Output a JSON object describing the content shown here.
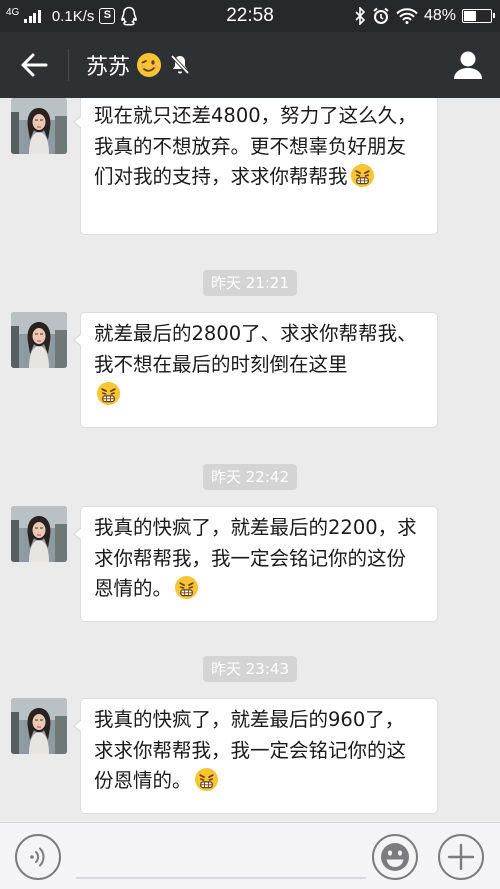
{
  "status_bar": {
    "network_type": "4G",
    "speed": "0.1K/s",
    "app_badge": "S",
    "time": "22:58",
    "battery_percent": "48%",
    "battery_level": 0.48
  },
  "header": {
    "contact_name": "苏苏",
    "icons": [
      "back-arrow-icon",
      "wink-emoji-icon",
      "mute-bell-icon",
      "contact-person-icon"
    ]
  },
  "messages": [
    {
      "type": "text",
      "text": "现在就只还差4800，努力了这么久，我真的不想放弃。更不想辜负好朋友们对我的支持，求求你帮帮我",
      "emoji": "grimace-emoji"
    },
    {
      "type": "timestamp",
      "text": "昨天 21:21"
    },
    {
      "type": "text",
      "text": "就差最后的2800了、求求你帮帮我、我不想在最后的时刻倒在这里",
      "emoji": "grimace-emoji"
    },
    {
      "type": "timestamp",
      "text": "昨天 22:42"
    },
    {
      "type": "text",
      "text": "我真的快疯了，就差最后的2200，求求你帮帮我，我一定会铭记你的这份恩情的。",
      "emoji": "grimace-emoji"
    },
    {
      "type": "timestamp",
      "text": "昨天 23:43"
    },
    {
      "type": "text",
      "text": "我真的快疯了，就差最后的960了，求求你帮帮我，我一定会铭记你的这份恩情的。",
      "emoji": "grimace-emoji"
    }
  ],
  "input_bar": {
    "text_value": "",
    "icons": [
      "voice-icon",
      "emoji-icon",
      "plus-icon"
    ]
  },
  "colors": {
    "status_bar_bg": "#26292b",
    "title_bar_bg": "#2e3133",
    "chat_bg": "#ebebeb",
    "bubble_bg": "#ffffff",
    "timestamp_bg": "#d4d4d4"
  }
}
